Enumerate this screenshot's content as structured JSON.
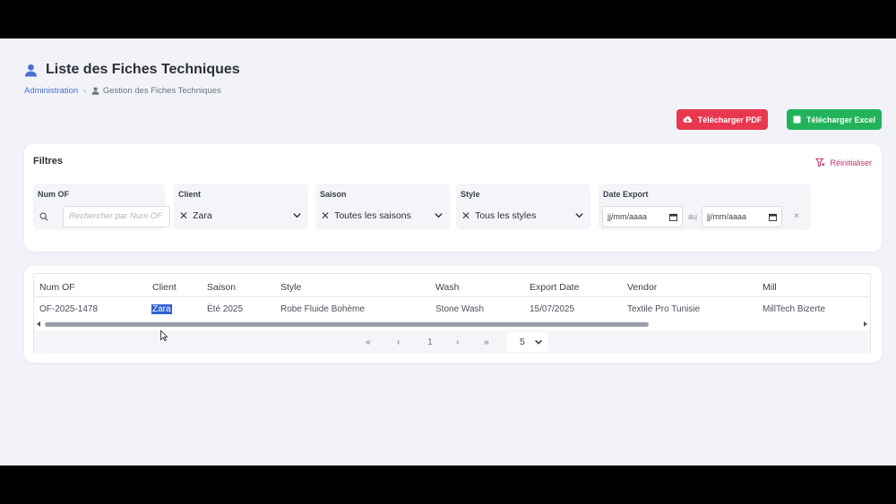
{
  "page": {
    "title": "Liste des Fiches Techniques",
    "breadcrumb": {
      "root": "Administration",
      "current": "Gestion des Fiches Techniques"
    }
  },
  "actions": {
    "pdf_label": "Télécharger PDF",
    "excel_label": "Télécharger Excel"
  },
  "filters": {
    "title": "Filtres",
    "reset_label": "Réinitialiser",
    "num_of": {
      "label": "Num OF",
      "placeholder": "Rechercher par Num OF"
    },
    "client": {
      "label": "Client",
      "value": "Zara"
    },
    "saison": {
      "label": "Saison",
      "value": "Toutes les saisons"
    },
    "style": {
      "label": "Style",
      "value": "Tous les styles"
    },
    "date_export": {
      "label": "Date Export",
      "from": "jj/mm/aaaa",
      "sep": "au",
      "to": "jj/mm/aaaa",
      "clear": "×"
    }
  },
  "table": {
    "columns": [
      "Num OF",
      "Client",
      "Saison",
      "Style",
      "Wash",
      "Export Date",
      "Vendor",
      "Mill"
    ],
    "rows": [
      [
        "OF-2025-1478",
        "Zara",
        "Été 2025",
        "Robe Fluide Bohème",
        "Stone Wash",
        "15/07/2025",
        "Textile Pro Tunisie",
        "MillTech Bizerte"
      ]
    ]
  },
  "pagination": {
    "first": "«",
    "prev": "‹",
    "page": "1",
    "next": "›",
    "last": "»",
    "page_size": "5"
  },
  "colors": {
    "accent": "#4a6fd1",
    "pdf": "#e8374f",
    "excel": "#22b35a",
    "reset": "#c2336b",
    "selection": "#2f5fd3"
  }
}
